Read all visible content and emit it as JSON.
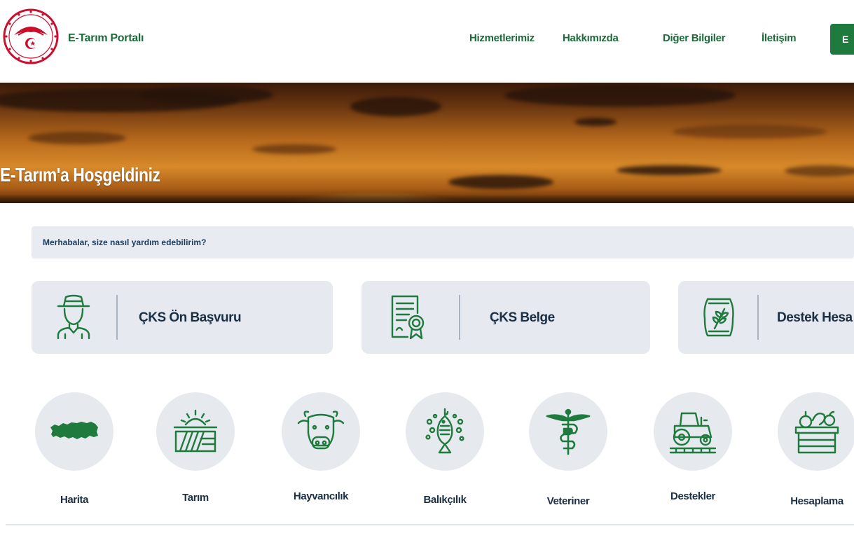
{
  "header": {
    "brand": "E-Tarım Portalı",
    "nav": [
      "Hizmetlerimiz",
      "Hakkımızda",
      "Diğer Bilgiler",
      "İletişim"
    ],
    "login_label": "E"
  },
  "hero": {
    "title": "E-Tarım'a Hoşgeldiniz"
  },
  "assistant": {
    "text": "Merhabalar, size nasıl yardım edebilirim?"
  },
  "quick_actions": [
    {
      "label": "ÇKS Ön Başvuru",
      "icon": "farmer-icon"
    },
    {
      "label": "ÇKS Belge",
      "icon": "certificate-icon"
    },
    {
      "label": "Destek Hesa",
      "icon": "seed-bag-icon"
    }
  ],
  "categories": [
    {
      "label": "Harita",
      "icon": "turkey-map-icon"
    },
    {
      "label": "Tarım",
      "icon": "field-sun-icon"
    },
    {
      "label": "Hayvancılık",
      "icon": "cow-icon"
    },
    {
      "label": "Balıkçılık",
      "icon": "fish-icon"
    },
    {
      "label": "Veteriner",
      "icon": "caduceus-icon"
    },
    {
      "label": "Destekler",
      "icon": "tractor-icon"
    },
    {
      "label": "Hesaplama",
      "icon": "produce-crate-icon"
    }
  ],
  "colors": {
    "brand_green": "#1e6b3a",
    "button_green": "#1f7a3d",
    "card_bg": "#e6e9f0",
    "label_dark": "#1b2f44"
  }
}
